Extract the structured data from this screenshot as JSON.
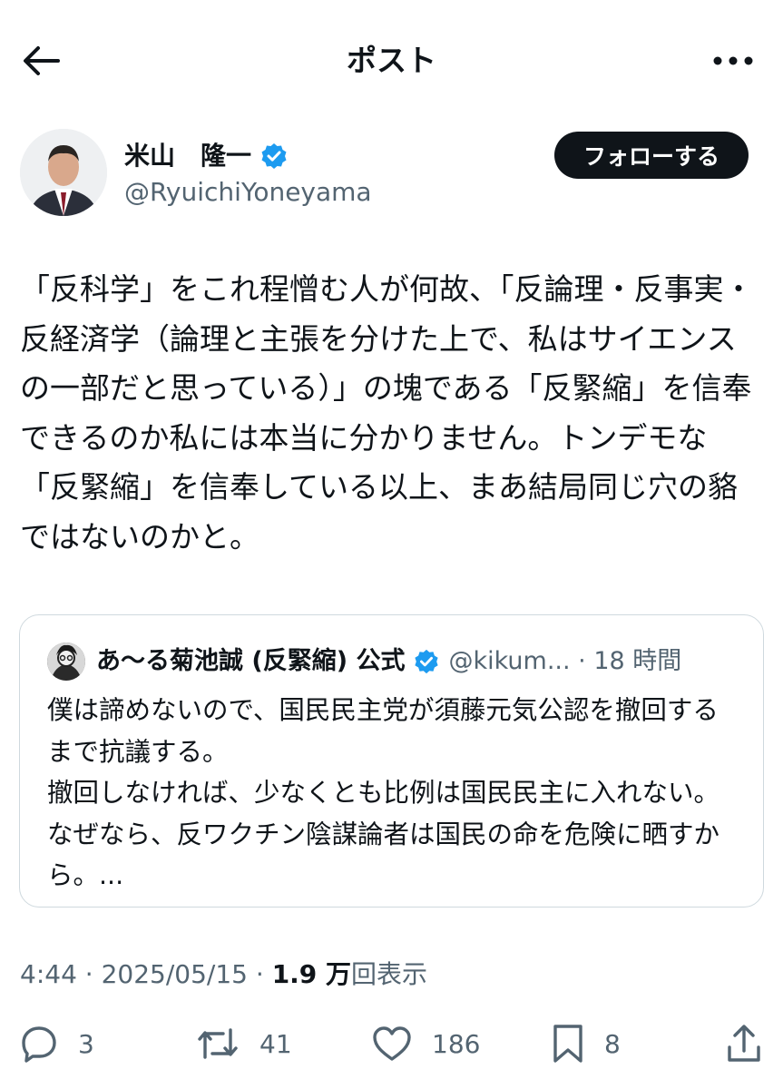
{
  "header": {
    "title": "ポスト"
  },
  "author": {
    "name": "米山　隆一",
    "handle": "@RyuichiYoneyama",
    "verified_color": "#1d9bf0",
    "follow_label": "フォローする"
  },
  "post": {
    "text": "「反科学」をこれ程憎む人が何故、「反論理・反事実・反経済学（論理と主張を分けた上で、私はサイエンスの一部だと思っている）」の塊である「反緊縮」を信奉できるのか私には本当に分かりません。トンデモな「反緊縮」を信奉している以上、まあ結局同じ穴の貉ではないのかと。",
    "time": "4:44",
    "date": "2025/05/15",
    "views_count": "1.9 万",
    "views_label": "回表示",
    "separator": " · "
  },
  "quote": {
    "name": "あ〜る菊池誠 (反緊縮) 公式",
    "handle": "@kikum...",
    "time": "18 時間",
    "separator": " · ",
    "text": "僕は諦めないので、国民民主党が須藤元気公認を撤回するまで抗議する。\n撤回しなければ、少なくとも比例は国民民主に入れない。なぜなら、反ワクチン陰謀論者は国民の命を危険に晒すから。..."
  },
  "actions": {
    "replies": "3",
    "reposts": "41",
    "likes": "186",
    "bookmarks": "8"
  },
  "icons": {
    "back": "arrow-left-icon",
    "more": "more-horizontal-icon",
    "verified": "verified-badge-icon",
    "reply": "reply-icon",
    "repost": "repost-icon",
    "like": "heart-icon",
    "bookmark": "bookmark-icon",
    "share": "share-icon"
  }
}
